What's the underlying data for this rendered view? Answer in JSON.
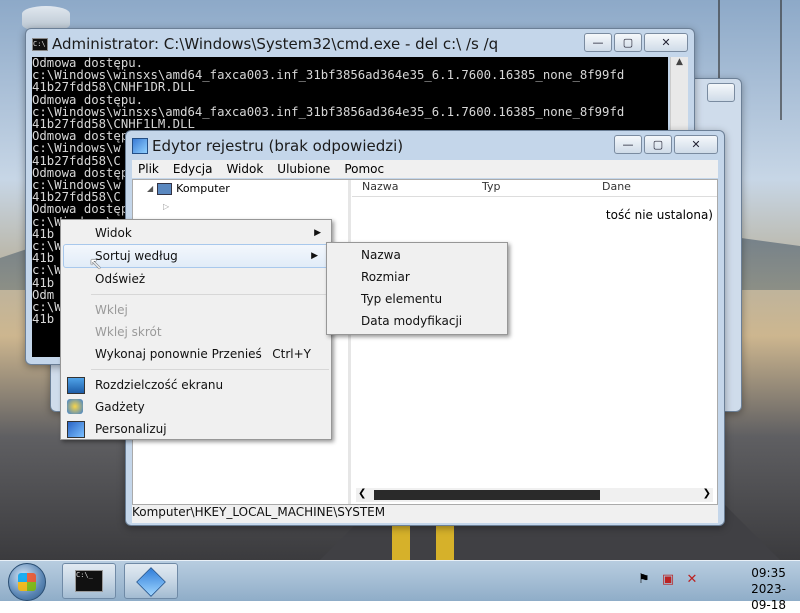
{
  "cmd": {
    "title": "Administrator: C:\\Windows\\System32\\cmd.exe - del  c:\\ /s /q",
    "lines": [
      "Odmowa dostępu.",
      "c:\\Windows\\winsxs\\amd64_faxca003.inf_31bf3856ad364e35_6.1.7600.16385_none_8f99fd",
      "41b27fdd58\\CNHF1DR.DLL",
      "Odmowa dostępu.",
      "c:\\Windows\\winsxs\\amd64_faxca003.inf_31bf3856ad364e35_6.1.7600.16385_none_8f99fd",
      "41b27fdd58\\CNHF1LM.DLL",
      "Odmowa dostępu.",
      "c:\\Windows\\w",
      "41b27fdd58\\C",
      "Odmowa dostępu.",
      "c:\\Windows\\w",
      "41b27fdd58\\C",
      "Odmowa dostępu.",
      "c:\\Windows\\w",
      "41b",
      "c:\\W",
      "41b",
      "c:\\W",
      "41b",
      "Odm",
      "c:\\W",
      "41b"
    ]
  },
  "regedit": {
    "title": "Edytor rejestru (brak odpowiedzi)",
    "menu": [
      "Plik",
      "Edycja",
      "Widok",
      "Ulubione",
      "Pomoc"
    ],
    "tree_root": "Komputer",
    "columns": [
      "Nazwa",
      "Typ",
      "Dane"
    ],
    "value_data": "tość nie ustalona)",
    "status": "Komputer\\HKEY_LOCAL_MACHINE\\SYSTEM"
  },
  "context_menu": {
    "items": [
      {
        "label": "Widok",
        "arrow": "▶"
      },
      {
        "label": "Sortuj według",
        "arrow": "▶"
      },
      {
        "label": "Odśwież"
      },
      {
        "label": "Wklej"
      },
      {
        "label": "Wklej skrót"
      },
      {
        "label": "Wykonaj ponownie Przenieś",
        "shortcut": "Ctrl+Y"
      },
      {
        "label": "Rozdzielczość ekranu"
      },
      {
        "label": "Gadżety"
      },
      {
        "label": "Personalizuj"
      }
    ]
  },
  "submenu": {
    "items": [
      "Nazwa",
      "Rozmiar",
      "Typ elementu",
      "Data modyfikacji"
    ]
  },
  "taskbar": {
    "cmd_icon_text": "C:\\_",
    "time": "09:35",
    "date": "2023-09-18"
  },
  "window_controls": {
    "minimize": "—",
    "maximize": "▢",
    "close": "✕"
  }
}
